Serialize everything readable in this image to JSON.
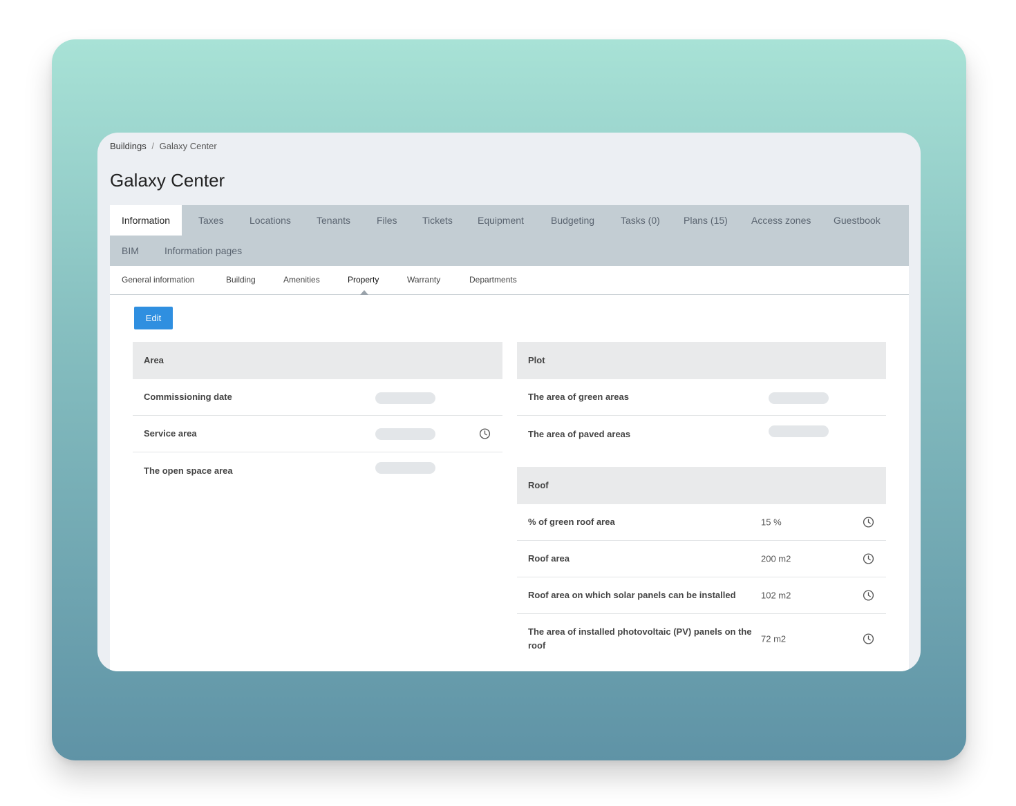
{
  "breadcrumb": {
    "parent": "Buildings",
    "separator": "/",
    "current": "Galaxy Center"
  },
  "page_title": "Galaxy Center",
  "tabs": [
    {
      "label": "Information"
    },
    {
      "label": "Taxes"
    },
    {
      "label": "Locations"
    },
    {
      "label": "Tenants"
    },
    {
      "label": "Files"
    },
    {
      "label": "Tickets"
    },
    {
      "label": "Equipment"
    },
    {
      "label": "Budgeting"
    },
    {
      "label": "Tasks (0)"
    },
    {
      "label": "Plans (15)"
    },
    {
      "label": "Access zones"
    },
    {
      "label": "Guestbook"
    },
    {
      "label": "BIM"
    },
    {
      "label": "Information pages"
    }
  ],
  "subtabs": [
    {
      "label": "General information"
    },
    {
      "label": "Building"
    },
    {
      "label": "Amenities"
    },
    {
      "label": "Property"
    },
    {
      "label": "Warranty"
    },
    {
      "label": "Departments"
    }
  ],
  "edit_label": "Edit",
  "area": {
    "title": "Area",
    "rows": [
      {
        "label": "Commissioning date"
      },
      {
        "label": "Service area"
      },
      {
        "label": "The open space area"
      }
    ]
  },
  "plot": {
    "title": "Plot",
    "rows": [
      {
        "label": "The area of green areas"
      },
      {
        "label": "The area of paved areas"
      }
    ]
  },
  "roof": {
    "title": "Roof",
    "rows": [
      {
        "label": "% of green roof area",
        "value": "15 %"
      },
      {
        "label": "Roof area",
        "value": "200 m2"
      },
      {
        "label": "Roof area on which solar panels can be installed",
        "value": "102 m2"
      },
      {
        "label": "The area of installed photovoltaic (PV) panels on the roof",
        "value": "72 m2"
      }
    ]
  }
}
